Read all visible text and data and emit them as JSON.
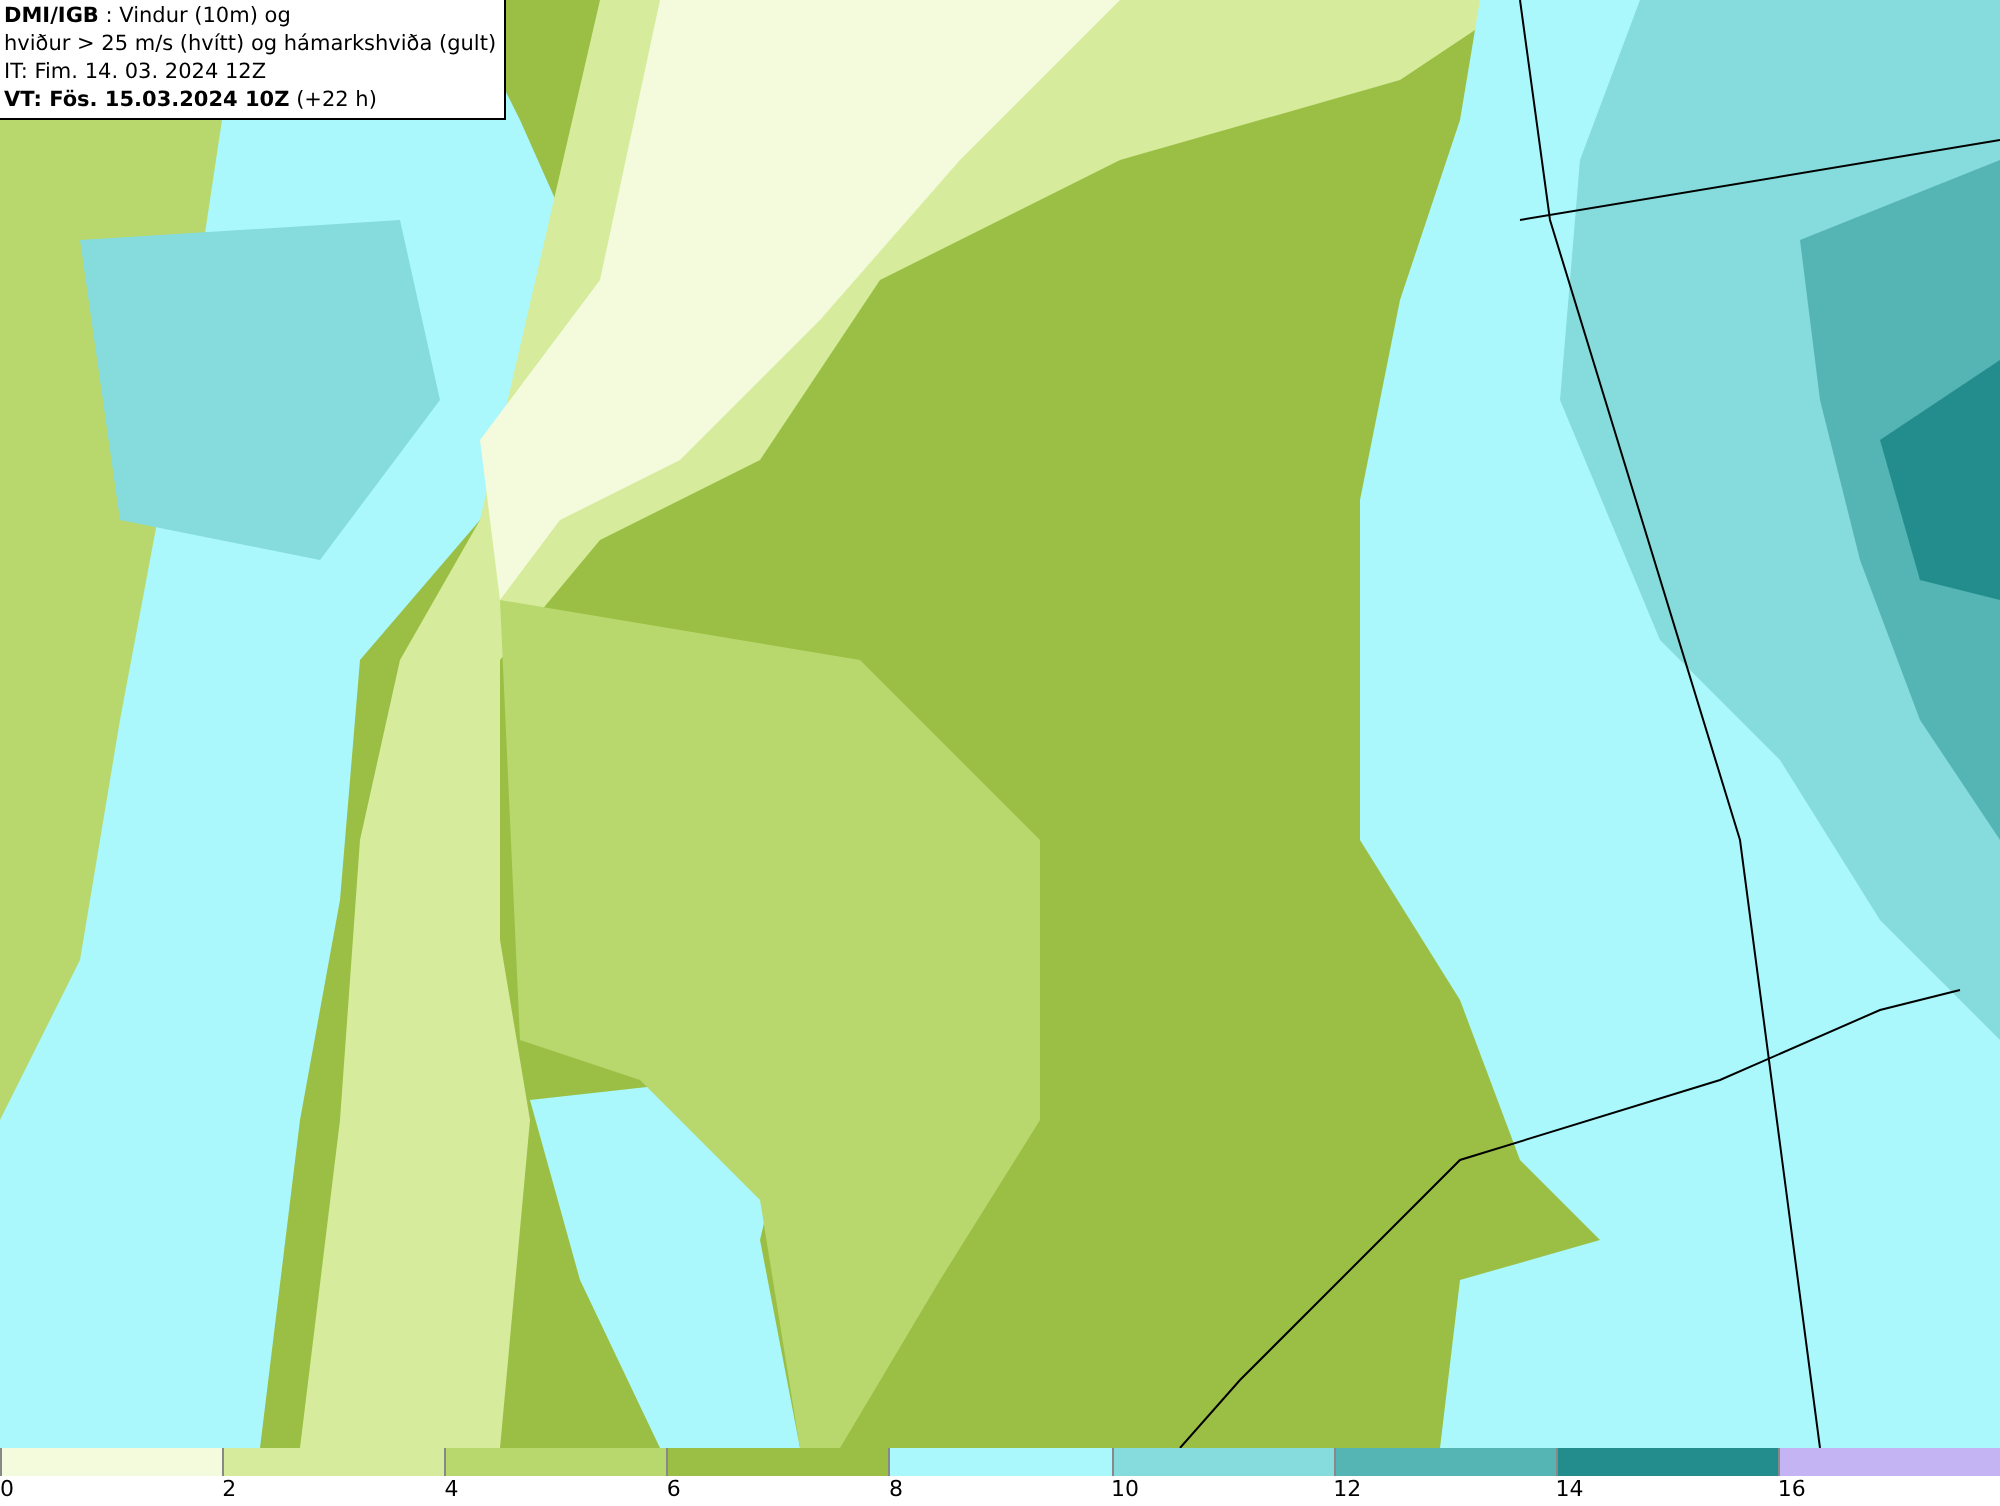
{
  "title_box": {
    "lines": [
      "**DMI/IGB** : Vindur (10m) og",
      "hviður > 25 m/s (hvítt) og hámarkshviða (gult)",
      "IT: Fim. 14. 03. 2024 12Z",
      "**VT: Fös. 15.03.2024 10Z** (+22 h)"
    ]
  },
  "legend": {
    "segments": [
      {
        "color": "#f4fadc"
      },
      {
        "color": "#d6ec9c"
      },
      {
        "color": "#b8d86e"
      },
      {
        "color": "#9bbf45"
      },
      {
        "color": "#aaf8fc"
      },
      {
        "color": "#86dcdc"
      },
      {
        "color": "#55b4b4"
      },
      {
        "color": "#238c8c"
      },
      {
        "color": "#c4b4f4"
      }
    ],
    "labels": [
      "0",
      "2",
      "4",
      "6",
      "8",
      "10",
      "12",
      "14",
      "16"
    ]
  }
}
